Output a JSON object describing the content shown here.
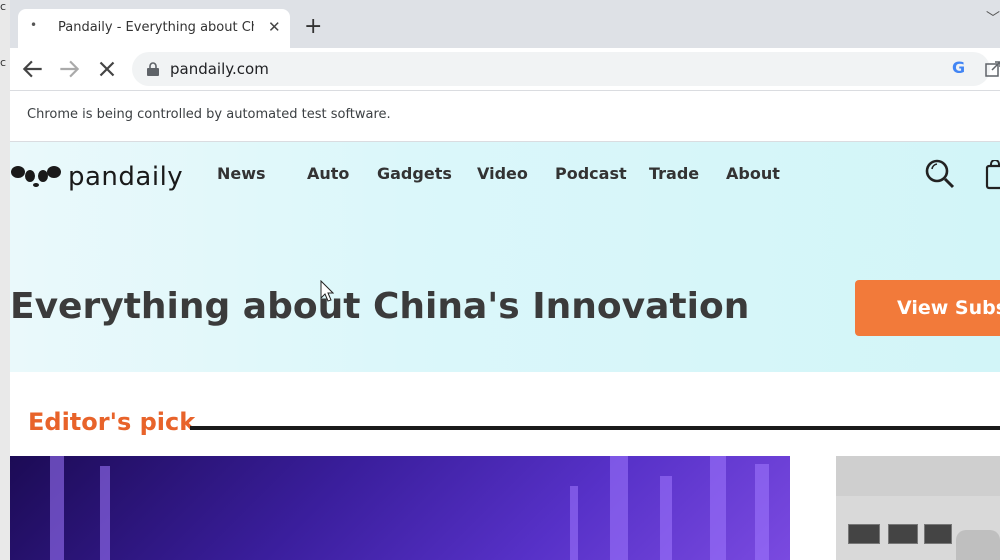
{
  "desktop": {
    "edge_glyph_top": "c",
    "edge_glyph_mid": "c"
  },
  "browser": {
    "tab_title": "Pandaily - Everything about China's Innovation",
    "url": "pandaily.com",
    "infobar_text": "Chrome is being controlled by automated test software."
  },
  "site": {
    "logo_text": "pandaily",
    "nav": [
      "News",
      "Auto",
      "Gadgets",
      "Video",
      "Podcast",
      "Trade",
      "About"
    ],
    "headline": "Everything about China's Innovation",
    "subscribe_label": "View Subscriptions",
    "section_title": "Editor's pick",
    "accent_color": "#e8632a",
    "button_color": "#f27a3a"
  }
}
